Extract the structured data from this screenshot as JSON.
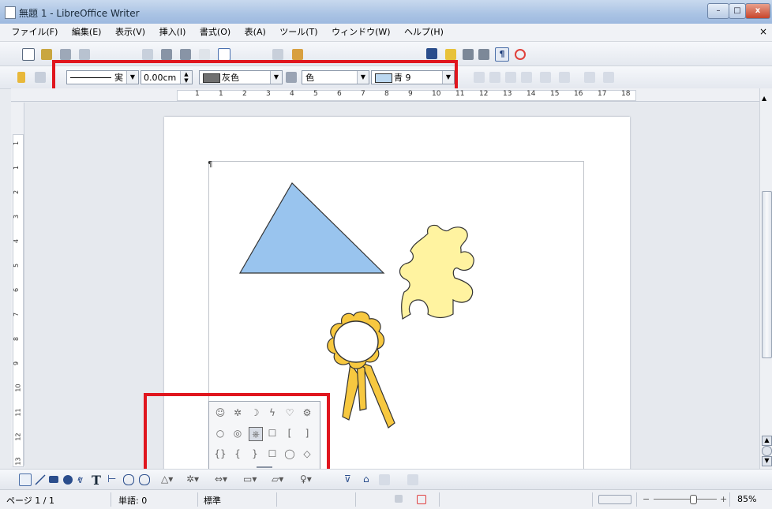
{
  "window": {
    "title": "無題 1 - LibreOffice Writer",
    "min": "–",
    "max": "□",
    "close": "x"
  },
  "menu": {
    "items": [
      "ファイル(F)",
      "編集(E)",
      "表示(V)",
      "挿入(I)",
      "書式(O)",
      "表(A)",
      "ツール(T)",
      "ウィンドウ(W)",
      "ヘルプ(H)"
    ],
    "close": "×"
  },
  "line_toolbar": {
    "line_style": "実",
    "line_width": "0.00cm",
    "line_color": "灰色",
    "line_color_swatch": "#707070",
    "area_style": "色",
    "area_color": "青 9",
    "area_color_swatch": "#bcd8f0"
  },
  "ruler": {
    "h_labels": [
      "1",
      "1",
      "2",
      "3",
      "4",
      "5",
      "6",
      "7",
      "8",
      "9",
      "10",
      "11",
      "12",
      "13",
      "14",
      "15",
      "16",
      "17",
      "18"
    ],
    "v_labels": [
      "1",
      "1",
      "2",
      "3",
      "4",
      "5",
      "6",
      "7",
      "8",
      "9",
      "10",
      "11",
      "12",
      "13"
    ]
  },
  "shapes": {
    "triangle_fill": "#99c4ee",
    "puzzle_fill": "#fff3a0",
    "ribbon_fill": "#f7c840",
    "stroke": "#333333"
  },
  "popup_symbols": [
    "☺",
    "✲",
    "☽",
    "ϟ",
    "♡",
    "⚙",
    "○",
    "◎",
    "⎈",
    "☐",
    "[",
    "]",
    "{}",
    "{",
    "}",
    "☐",
    "◯",
    "◇"
  ],
  "status": {
    "page": "ページ 1 / 1",
    "words": "単語: 0",
    "style": "標準",
    "zoom": "85%"
  }
}
